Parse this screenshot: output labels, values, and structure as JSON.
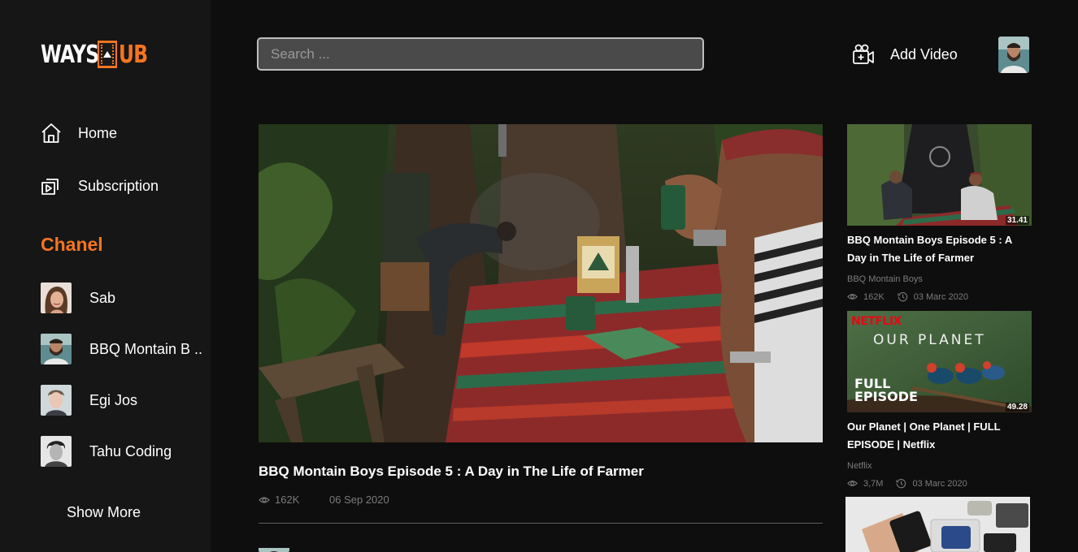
{
  "brand": {
    "logo_left": "WAYS",
    "logo_right": "UB",
    "accent": "#f47521"
  },
  "sidebar": {
    "nav": [
      {
        "label": "Home",
        "icon": "home-icon"
      },
      {
        "label": "Subscription",
        "icon": "subscription-icon"
      }
    ],
    "chanel_title": "Chanel",
    "channels": [
      {
        "name": "Sab"
      },
      {
        "name": "BBQ Montain B .."
      },
      {
        "name": "Egi Jos"
      },
      {
        "name": "Tahu Coding"
      }
    ],
    "show_more": "Show More"
  },
  "header": {
    "search_placeholder": "Search ...",
    "add_video_label": "Add Video"
  },
  "main_video": {
    "title": "BBQ Montain Boys Episode 5 : A Day in The Life of Farmer",
    "views": "162K",
    "date": "06 Sep 2020"
  },
  "recommended": [
    {
      "title": "BBQ Montain Boys Episode 5 : A Day in The Life of Farmer",
      "channel": "BBQ Montain Boys",
      "views": "162K",
      "date": "03 Marc 2020",
      "duration": "31.41"
    },
    {
      "title": "Our Planet | One Planet | FULL EPISODE | Netflix",
      "channel": "Netflix",
      "views": "3,7M",
      "date": "03 Marc 2020",
      "duration": "49.28",
      "thumb_text": {
        "brand": "NETFLIX",
        "show": "OUR PLANET",
        "badge_line1": "FULL",
        "badge_line2": "EPISODE"
      }
    }
  ]
}
